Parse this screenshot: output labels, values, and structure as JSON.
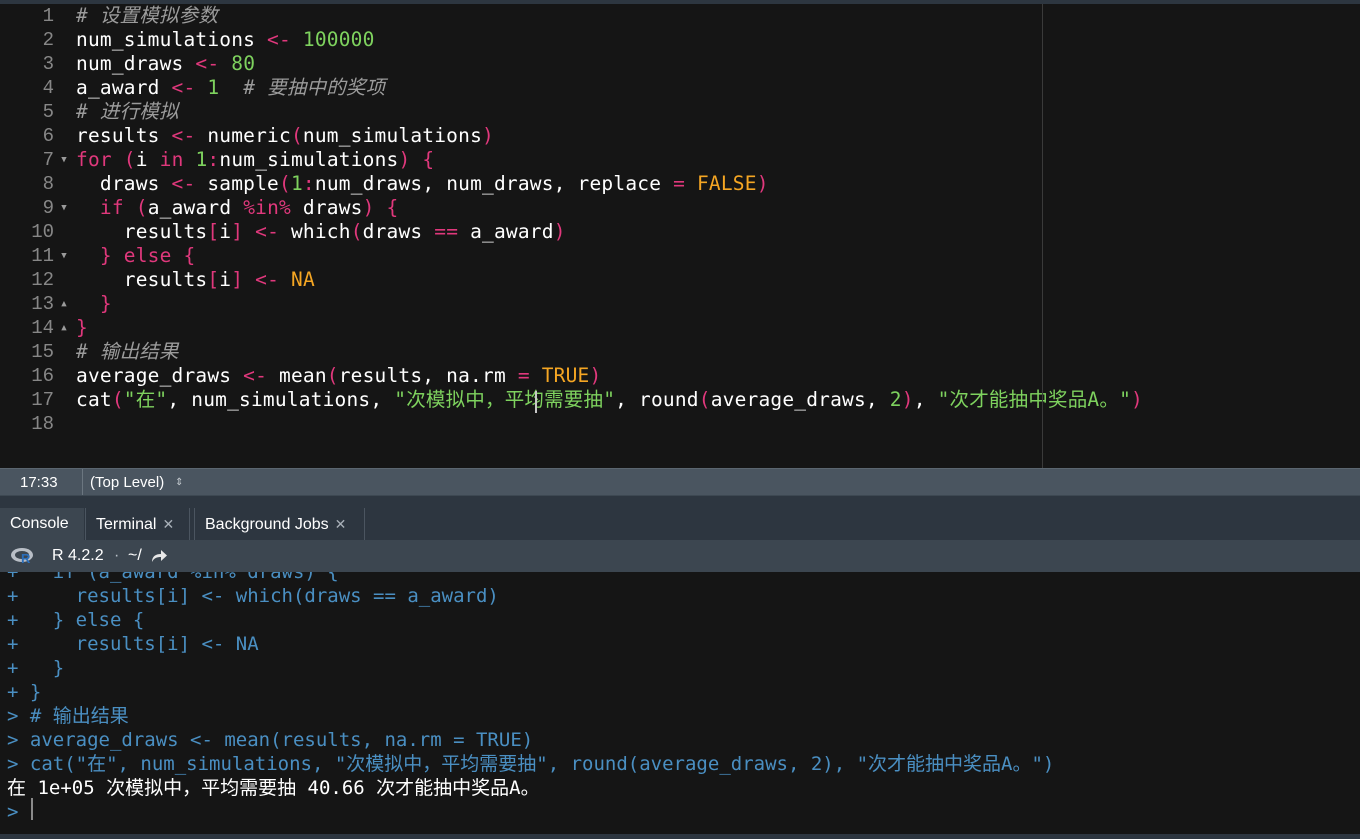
{
  "editor": {
    "line_numbers": [
      "1",
      "2",
      "3",
      "4",
      "5",
      "6",
      "7",
      "8",
      "9",
      "10",
      "11",
      "12",
      "13",
      "14",
      "15",
      "16",
      "17",
      "18"
    ],
    "fold_markers": [
      {
        "line": "7",
        "glyph": "▼"
      },
      {
        "line": "9",
        "glyph": "▼"
      },
      {
        "line": "11",
        "glyph": "▼"
      },
      {
        "line": "13",
        "glyph": "▲"
      },
      {
        "line": "14",
        "glyph": "▲"
      }
    ],
    "lines": [
      [
        {
          "t": "cm",
          "v": "# 设置模拟参数"
        }
      ],
      [
        {
          "t": "pn",
          "v": "num_simulations "
        },
        {
          "t": "op",
          "v": "<-"
        },
        {
          "t": "pn",
          "v": " "
        },
        {
          "t": "nm",
          "v": "100000"
        }
      ],
      [
        {
          "t": "pn",
          "v": "num_draws "
        },
        {
          "t": "op",
          "v": "<-"
        },
        {
          "t": "pn",
          "v": " "
        },
        {
          "t": "nm",
          "v": "80"
        }
      ],
      [
        {
          "t": "pn",
          "v": "a_award "
        },
        {
          "t": "op",
          "v": "<-"
        },
        {
          "t": "pn",
          "v": " "
        },
        {
          "t": "nm",
          "v": "1"
        },
        {
          "t": "pn",
          "v": "  "
        },
        {
          "t": "cm",
          "v": "# 要抽中的奖项"
        }
      ],
      [
        {
          "t": "cm",
          "v": "# 进行模拟"
        }
      ],
      [
        {
          "t": "pn",
          "v": "results "
        },
        {
          "t": "op",
          "v": "<-"
        },
        {
          "t": "pn",
          "v": " numeric"
        },
        {
          "t": "op",
          "v": "("
        },
        {
          "t": "pn",
          "v": "num_simulations"
        },
        {
          "t": "op",
          "v": ")"
        }
      ],
      [
        {
          "t": "kw",
          "v": "for"
        },
        {
          "t": "pn",
          "v": " "
        },
        {
          "t": "op",
          "v": "("
        },
        {
          "t": "pn",
          "v": "i "
        },
        {
          "t": "kw",
          "v": "in"
        },
        {
          "t": "pn",
          "v": " "
        },
        {
          "t": "nm",
          "v": "1"
        },
        {
          "t": "op",
          "v": ":"
        },
        {
          "t": "pn",
          "v": "num_simulations"
        },
        {
          "t": "op",
          "v": ")"
        },
        {
          "t": "pn",
          "v": " "
        },
        {
          "t": "op",
          "v": "{"
        }
      ],
      [
        {
          "t": "pn",
          "v": "  draws "
        },
        {
          "t": "op",
          "v": "<-"
        },
        {
          "t": "pn",
          "v": " sample"
        },
        {
          "t": "op",
          "v": "("
        },
        {
          "t": "nm",
          "v": "1"
        },
        {
          "t": "op",
          "v": ":"
        },
        {
          "t": "pn",
          "v": "num_draws, num_draws, replace "
        },
        {
          "t": "op",
          "v": "="
        },
        {
          "t": "pn",
          "v": " "
        },
        {
          "t": "cs",
          "v": "FALSE"
        },
        {
          "t": "op",
          "v": ")"
        }
      ],
      [
        {
          "t": "pn",
          "v": "  "
        },
        {
          "t": "kw",
          "v": "if"
        },
        {
          "t": "pn",
          "v": " "
        },
        {
          "t": "op",
          "v": "("
        },
        {
          "t": "pn",
          "v": "a_award "
        },
        {
          "t": "op",
          "v": "%in%"
        },
        {
          "t": "pn",
          "v": " draws"
        },
        {
          "t": "op",
          "v": ")"
        },
        {
          "t": "pn",
          "v": " "
        },
        {
          "t": "op",
          "v": "{"
        }
      ],
      [
        {
          "t": "pn",
          "v": "    results"
        },
        {
          "t": "op",
          "v": "["
        },
        {
          "t": "pn",
          "v": "i"
        },
        {
          "t": "op",
          "v": "]"
        },
        {
          "t": "pn",
          "v": " "
        },
        {
          "t": "op",
          "v": "<-"
        },
        {
          "t": "pn",
          "v": " which"
        },
        {
          "t": "op",
          "v": "("
        },
        {
          "t": "pn",
          "v": "draws "
        },
        {
          "t": "op",
          "v": "=="
        },
        {
          "t": "pn",
          "v": " a_award"
        },
        {
          "t": "op",
          "v": ")"
        }
      ],
      [
        {
          "t": "pn",
          "v": "  "
        },
        {
          "t": "op",
          "v": "}"
        },
        {
          "t": "pn",
          "v": " "
        },
        {
          "t": "kw",
          "v": "else"
        },
        {
          "t": "pn",
          "v": " "
        },
        {
          "t": "op",
          "v": "{"
        }
      ],
      [
        {
          "t": "pn",
          "v": "    results"
        },
        {
          "t": "op",
          "v": "["
        },
        {
          "t": "pn",
          "v": "i"
        },
        {
          "t": "op",
          "v": "]"
        },
        {
          "t": "pn",
          "v": " "
        },
        {
          "t": "op",
          "v": "<-"
        },
        {
          "t": "pn",
          "v": " "
        },
        {
          "t": "cs",
          "v": "NA"
        }
      ],
      [
        {
          "t": "pn",
          "v": "  "
        },
        {
          "t": "op",
          "v": "}"
        }
      ],
      [
        {
          "t": "op",
          "v": "}"
        }
      ],
      [
        {
          "t": "cm",
          "v": "# 输出结果"
        }
      ],
      [
        {
          "t": "pn",
          "v": "average_draws "
        },
        {
          "t": "op",
          "v": "<-"
        },
        {
          "t": "pn",
          "v": " mean"
        },
        {
          "t": "op",
          "v": "("
        },
        {
          "t": "pn",
          "v": "results, na.rm "
        },
        {
          "t": "op",
          "v": "="
        },
        {
          "t": "pn",
          "v": " "
        },
        {
          "t": "cs",
          "v": "TRUE"
        },
        {
          "t": "op",
          "v": ")"
        }
      ],
      [
        {
          "t": "pn",
          "v": "cat"
        },
        {
          "t": "op",
          "v": "("
        },
        {
          "t": "st",
          "v": "\"在\""
        },
        {
          "t": "pn",
          "v": ", num_simulations, "
        },
        {
          "t": "st",
          "v": "\"次模拟中，平均需要抽\""
        },
        {
          "t": "pn",
          "v": ", round"
        },
        {
          "t": "op",
          "v": "("
        },
        {
          "t": "pn",
          "v": "average_draws, "
        },
        {
          "t": "nm",
          "v": "2"
        },
        {
          "t": "op",
          "v": ")"
        },
        {
          "t": "pn",
          "v": ", "
        },
        {
          "t": "st",
          "v": "\"次才能抽中奖品A。\""
        },
        {
          "t": "op",
          "v": ")"
        }
      ],
      []
    ]
  },
  "status_bar": {
    "cursor_position": "17:33",
    "scope": "(Top Level)",
    "scope_arrow": "⇕"
  },
  "console_tabs": {
    "console": "Console",
    "terminal": "Terminal",
    "background_jobs": "Background Jobs",
    "close_glyph": "✕"
  },
  "console_header": {
    "r_version": "R 4.2.2",
    "separator": "·",
    "working_dir": "~/"
  },
  "console_lines": [
    {
      "kind": "in",
      "text": "+   if (a_award %in% draws) {"
    },
    {
      "kind": "in",
      "text": "+     results[i] <- which(draws == a_award)"
    },
    {
      "kind": "in",
      "text": "+   } else {"
    },
    {
      "kind": "in",
      "text": "+     results[i] <- NA"
    },
    {
      "kind": "in",
      "text": "+   }"
    },
    {
      "kind": "in",
      "text": "+ }"
    },
    {
      "kind": "in",
      "text": "> # 输出结果"
    },
    {
      "kind": "in",
      "text": "> average_draws <- mean(results, na.rm = TRUE)"
    },
    {
      "kind": "in",
      "text": "> cat(\"在\", num_simulations, \"次模拟中，平均需要抽\", round(average_draws, 2), \"次才能抽中奖品A。\")"
    },
    {
      "kind": "out",
      "text": "在 1e+05 次模拟中，平均需要抽 40.66 次才能抽中奖品A。"
    },
    {
      "kind": "in",
      "text": "> "
    }
  ],
  "colors": {
    "background": "#151515",
    "keyword": "#e0387c",
    "constant": "#f5a623",
    "number_string": "#7ed25e",
    "comment": "#9b9b9b",
    "console_input": "#4a8fc2",
    "panel": "#3c4650"
  },
  "icons": {
    "r_logo": "r-logo-icon",
    "goto_dir": "goto-directory-icon",
    "close_tab": "close-icon"
  }
}
